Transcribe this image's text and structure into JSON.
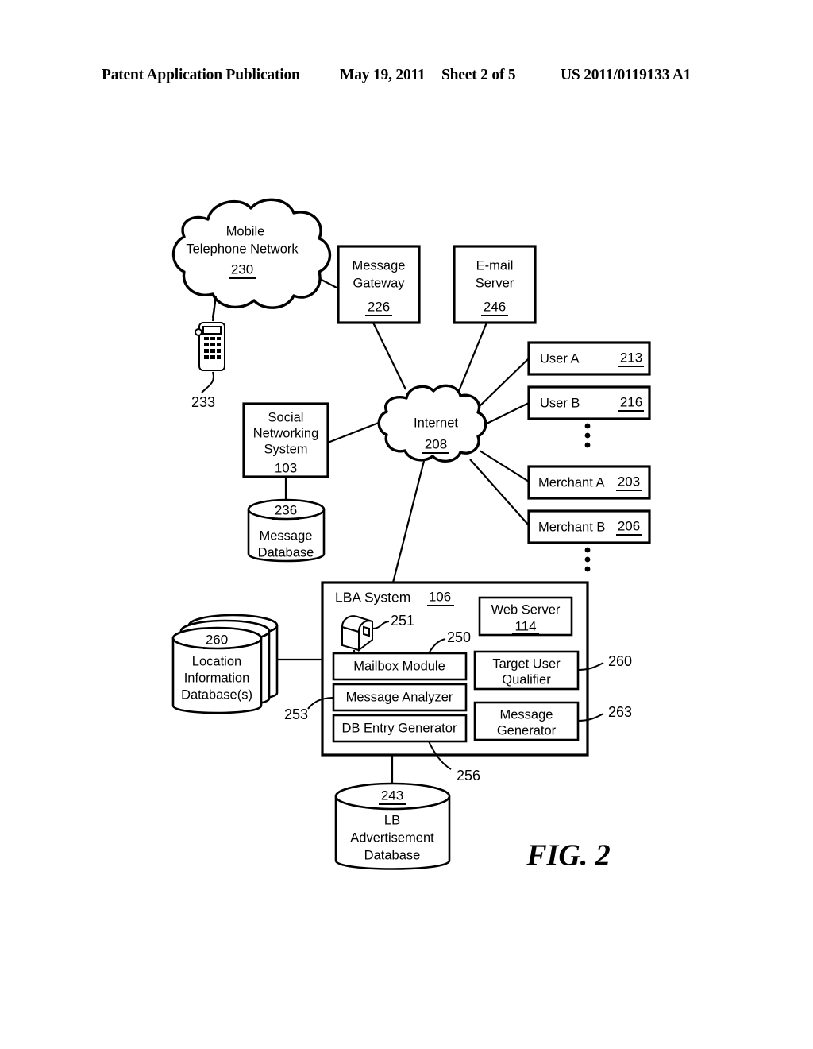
{
  "header": {
    "publication": "Patent Application Publication",
    "date": "May 19, 2011",
    "sheet": "Sheet 2 of 5",
    "patent_number": "US 2011/0119133 A1"
  },
  "figure": {
    "caption": "FIG. 2"
  },
  "nodes": {
    "mobile_network": {
      "line1": "Mobile",
      "line2": "Telephone Network",
      "ref": "230"
    },
    "mobile_device": {
      "ref": "233"
    },
    "message_gateway": {
      "line1": "Message",
      "line2": "Gateway",
      "ref": "226"
    },
    "email_server": {
      "line1": "E-mail",
      "line2": "Server",
      "ref": "246"
    },
    "internet": {
      "label": "Internet",
      "ref": "208"
    },
    "user_a": {
      "label": "User A",
      "ref": "213"
    },
    "user_b": {
      "label": "User B",
      "ref": "216"
    },
    "merchant_a": {
      "label": "Merchant A",
      "ref": "203"
    },
    "merchant_b": {
      "label": "Merchant B",
      "ref": "206"
    },
    "social_networking_system": {
      "line1": "Social",
      "line2": "Networking",
      "line3": "System",
      "ref": "103"
    },
    "message_database": {
      "ref": "236",
      "line1": "Message",
      "line2": "Database"
    },
    "location_information_database": {
      "ref": "260",
      "line1": "Location",
      "line2": "Information",
      "line3": "Database(s)"
    },
    "lba_system": {
      "label": "LBA System",
      "ref": "106"
    },
    "web_server": {
      "label": "Web Server",
      "ref": "114"
    },
    "mailbox_icon": {
      "ref": "251"
    },
    "mailbox_module": {
      "label": "Mailbox Module",
      "ref": "250"
    },
    "message_analyzer": {
      "label": "Message Analyzer",
      "ref": "253"
    },
    "db_entry_generator": {
      "label": "DB Entry Generator",
      "ref": "256"
    },
    "target_user_qualifier": {
      "line1": "Target User",
      "line2": "Qualifier",
      "ref": "260"
    },
    "message_generator": {
      "line1": "Message",
      "line2": "Generator",
      "ref": "263"
    },
    "lb_advertisement_database": {
      "ref": "243",
      "line1": "LB",
      "line2": "Advertisement",
      "line3": "Database"
    }
  },
  "ellipsis": {
    "users": "⋮",
    "merchants": "⋮"
  },
  "colors": {
    "stroke": "#000000",
    "fill": "#ffffff"
  }
}
